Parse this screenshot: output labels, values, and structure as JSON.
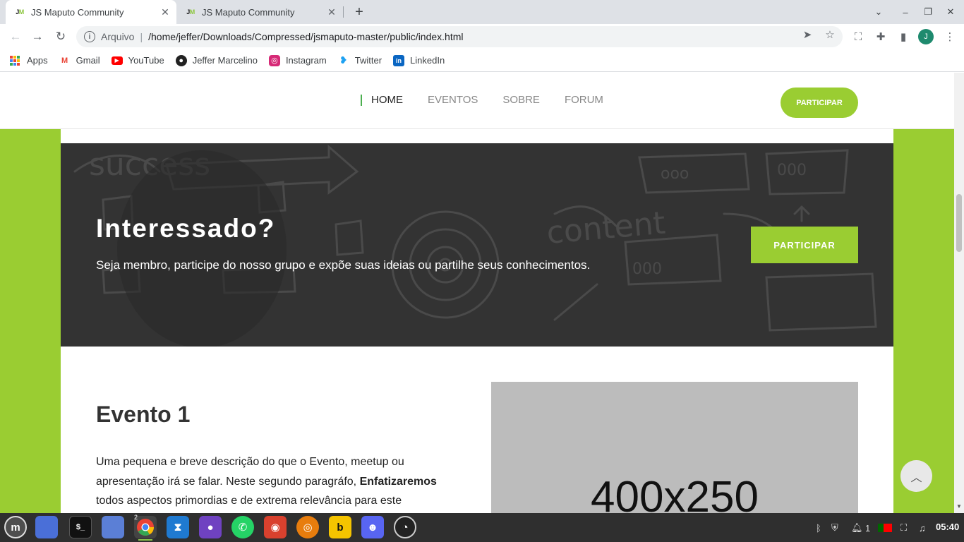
{
  "browser": {
    "tabs": [
      {
        "label": "JS Maputo Community",
        "favicon": "JM",
        "active": true
      },
      {
        "label": "JS Maputo Community",
        "favicon": "JM",
        "active": false
      }
    ],
    "address": {
      "scheme_label": "Arquivo",
      "url": "/home/jeffer/Downloads/Compressed/jsmaputo-master/public/index.html"
    },
    "profile_initial": "J",
    "bookmarks": [
      {
        "label": "Apps",
        "icon": "apps-grid-icon"
      },
      {
        "label": "Gmail",
        "icon": "gmail-icon"
      },
      {
        "label": "YouTube",
        "icon": "youtube-icon"
      },
      {
        "label": "Jeffer Marcelino",
        "icon": "github-icon"
      },
      {
        "label": "Instagram",
        "icon": "instagram-icon"
      },
      {
        "label": "Twitter",
        "icon": "twitter-icon"
      },
      {
        "label": "LinkedIn",
        "icon": "linkedin-icon"
      }
    ]
  },
  "site": {
    "nav": {
      "items": [
        {
          "label": "HOME",
          "active": true
        },
        {
          "label": "EVENTOS",
          "active": false
        },
        {
          "label": "SOBRE",
          "active": false
        },
        {
          "label": "FORUM",
          "active": false
        }
      ],
      "cta": "PARTICIPAR"
    },
    "banner": {
      "title": "Interessado?",
      "subtitle": "Seja membro, participe do nosso grupo e expõe suas ideias ou partilhe seus conhecimentos.",
      "cta": "PARTICIPAR",
      "doodle_words": [
        "success",
        "content",
        "ooo",
        "000"
      ]
    },
    "event": {
      "title": "Evento 1",
      "desc_part1": "Uma pequena e breve descrição do que o Evento, meetup ou apresentação irá se falar. Neste segundo paragráfo, ",
      "desc_bold": "Enfatizaremos",
      "desc_part2": " todos aspectos primordias e de extrema relevância para este",
      "image_placeholder": "400x250"
    }
  },
  "colors": {
    "accent": "#9acd32",
    "banner_bg": "#333333",
    "placeholder_bg": "#bcbcbc"
  },
  "taskbar": {
    "apps": [
      "mint-menu-icon",
      "show-desktop-icon",
      "terminal-icon",
      "files-icon",
      "chrome-icon",
      "vscode-icon",
      "github-desktop-icon",
      "whatsapp-icon",
      "gimp-icon",
      "blender-icon",
      "bitwarden-icon",
      "discord-icon",
      "obs-icon"
    ],
    "chrome_badge": "2",
    "tray": {
      "notifications_count": "1"
    },
    "clock": "05:40"
  }
}
